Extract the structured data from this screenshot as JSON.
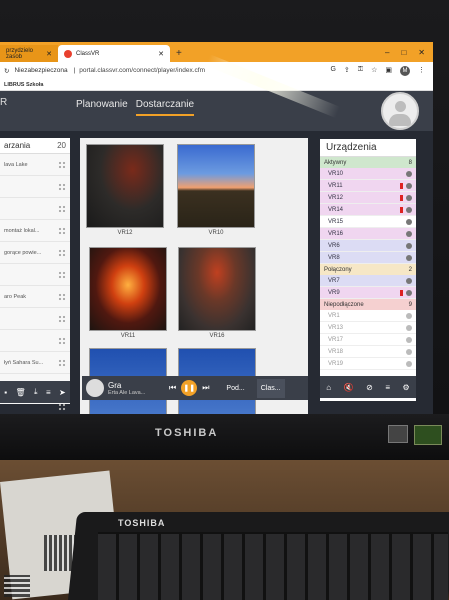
{
  "browser": {
    "tabs": [
      {
        "label": "przydzielo zasob",
        "active": false
      },
      {
        "label": "ClassVR",
        "active": true
      }
    ],
    "new_tab": "+",
    "window_controls": [
      "–",
      "□",
      "✕"
    ],
    "address": {
      "security": "Niezabezpieczona",
      "url": "portal.classvr.com/connect/player/index.cfm"
    },
    "profile_initial": "M",
    "bookmark": "LIBRUS Szkoła"
  },
  "app": {
    "logo_fragment": "R",
    "nav": [
      {
        "label": "Planowanie",
        "active": false
      },
      {
        "label": "Dostarczanie",
        "active": true
      }
    ]
  },
  "left_panel": {
    "title": "arzania",
    "count": "20",
    "items": [
      "lava Lake",
      "",
      "",
      "montaż lokal...",
      "gorące powie...",
      "",
      "aro Peak",
      "",
      "",
      "łyń Sahara Su...",
      "Republika Pol...",
      "",
      "a Konga"
    ]
  },
  "gallery": {
    "items": [
      {
        "label": "VR12",
        "thumb": "dark"
      },
      {
        "label": "VR10",
        "thumb": "sky"
      },
      {
        "label": "VR11",
        "thumb": "lava"
      },
      {
        "label": "VR16",
        "thumb": "rock"
      },
      {
        "label": "",
        "thumb": "blue"
      },
      {
        "label": "",
        "thumb": "blue"
      }
    ]
  },
  "player": {
    "title": "Gra",
    "subtitle": "Erta Ale Lava...",
    "tabs": [
      {
        "label": "Pod...",
        "active": false
      },
      {
        "label": "Clas...",
        "active": true
      }
    ]
  },
  "devices": {
    "title": "Urządzenia",
    "groups": [
      {
        "name": "Aktywny",
        "count": "8",
        "style": "active",
        "items": [
          {
            "label": "VR10",
            "style": "hl",
            "battery": false
          },
          {
            "label": "VR11",
            "style": "hl",
            "battery": true
          },
          {
            "label": "VR12",
            "style": "hl",
            "battery": true
          },
          {
            "label": "VR14",
            "style": "hl",
            "battery": true
          },
          {
            "label": "VR15",
            "style": "",
            "battery": false
          },
          {
            "label": "VR16",
            "style": "hl",
            "battery": false
          },
          {
            "label": "VR6",
            "style": "blue",
            "battery": false
          },
          {
            "label": "VR8",
            "style": "blue",
            "battery": false
          }
        ]
      },
      {
        "name": "Połączony",
        "count": "2",
        "style": "connected",
        "items": [
          {
            "label": "VR7",
            "style": "blue",
            "battery": false
          },
          {
            "label": "VR9",
            "style": "hl",
            "battery": true
          }
        ]
      },
      {
        "name": "Niepodłączone",
        "count": "9",
        "style": "disconnected",
        "items": [
          {
            "label": "VR1",
            "style": "grey",
            "battery": false
          },
          {
            "label": "VR13",
            "style": "grey",
            "battery": false
          },
          {
            "label": "VR17",
            "style": "grey",
            "battery": false
          },
          {
            "label": "VR18",
            "style": "grey",
            "battery": false
          },
          {
            "label": "VR19",
            "style": "grey",
            "battery": false
          }
        ]
      }
    ]
  },
  "hardware": {
    "monitor_brand": "TOSHIBA",
    "keyboard_brand": "TOSHIBA"
  },
  "colors": {
    "accent": "#f2a127",
    "header": "#3a3f49"
  }
}
